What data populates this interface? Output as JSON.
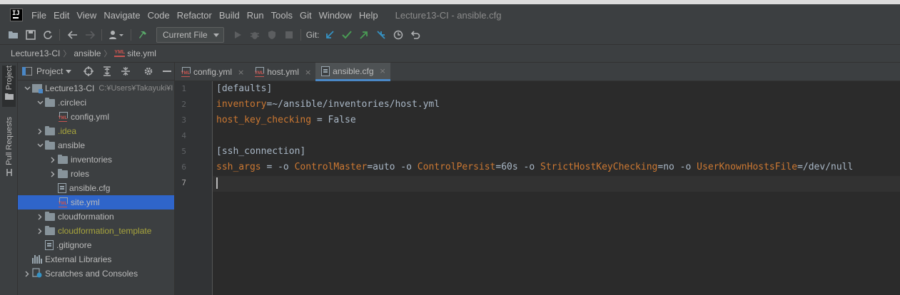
{
  "window": {
    "title": "Lecture13-CI - ansible.cfg",
    "logo_text": "IJ"
  },
  "menu": [
    "File",
    "Edit",
    "View",
    "Navigate",
    "Code",
    "Refactor",
    "Build",
    "Run",
    "Tools",
    "Git",
    "Window",
    "Help"
  ],
  "toolbar": {
    "run_config": "Current File",
    "git_label": "Git:"
  },
  "breadcrumb": {
    "project": "Lecture13-CI",
    "folder": "ansible",
    "file": "site.yml",
    "file_badge": "YML"
  },
  "side_stripe": {
    "project": "Project",
    "pull_requests": "Pull Requests"
  },
  "project_panel": {
    "title": "Project",
    "tree": [
      {
        "label": "Lecture13-CI",
        "hint": "C:¥Users¥Takayuki¥I",
        "icon": "module",
        "arrow": "down",
        "depth": 0
      },
      {
        "label": ".circleci",
        "icon": "folder",
        "arrow": "down",
        "depth": 1
      },
      {
        "label": "config.yml",
        "icon": "yml",
        "arrow": "",
        "depth": 2
      },
      {
        "label": ".idea",
        "icon": "folder",
        "arrow": "right",
        "depth": 1,
        "excluded": true
      },
      {
        "label": "ansible",
        "icon": "folder",
        "arrow": "down",
        "depth": 1
      },
      {
        "label": "inventories",
        "icon": "folder",
        "arrow": "right",
        "depth": 2
      },
      {
        "label": "roles",
        "icon": "folder",
        "arrow": "right",
        "depth": 2
      },
      {
        "label": "ansible.cfg",
        "icon": "cfg",
        "arrow": "",
        "depth": 2
      },
      {
        "label": "site.yml",
        "icon": "yml",
        "arrow": "",
        "depth": 2,
        "selected": true
      },
      {
        "label": "cloudformation",
        "icon": "folder",
        "arrow": "right",
        "depth": 1
      },
      {
        "label": "cloudformation_template",
        "icon": "folder",
        "arrow": "right",
        "depth": 1,
        "excluded": true
      },
      {
        "label": ".gitignore",
        "icon": "cfg",
        "arrow": "",
        "depth": 1
      },
      {
        "label": "External Libraries",
        "icon": "lib",
        "arrow": "",
        "depth": 0
      },
      {
        "label": "Scratches and Consoles",
        "icon": "scratch",
        "arrow": "right",
        "depth": 0
      }
    ]
  },
  "tabs": [
    {
      "label": "config.yml",
      "icon": "yml",
      "active": false
    },
    {
      "label": "host.yml",
      "icon": "yml",
      "active": false
    },
    {
      "label": "ansible.cfg",
      "icon": "cfg",
      "active": true
    }
  ],
  "tab_close": "×",
  "editor": {
    "lines": [
      {
        "num": "1",
        "parts": [
          [
            "p",
            "[defaults]"
          ]
        ]
      },
      {
        "num": "2",
        "parts": [
          [
            "k",
            "inventory"
          ],
          [
            "p",
            "=~/ansible/inventories/host.yml"
          ]
        ]
      },
      {
        "num": "3",
        "parts": [
          [
            "k",
            "host_key_checking"
          ],
          [
            "p",
            " = False"
          ]
        ]
      },
      {
        "num": "4",
        "parts": []
      },
      {
        "num": "5",
        "parts": [
          [
            "p",
            "[ssh_connection]"
          ]
        ]
      },
      {
        "num": "6",
        "parts": [
          [
            "k",
            "ssh_args"
          ],
          [
            "p",
            " = -o "
          ],
          [
            "k",
            "ControlMaster"
          ],
          [
            "p",
            "=auto -o "
          ],
          [
            "k",
            "ControlPersist"
          ],
          [
            "p",
            "=60s -o "
          ],
          [
            "k",
            "StrictHostKeyChecking"
          ],
          [
            "p",
            "=no -o "
          ],
          [
            "k",
            "UserKnownHostsFile"
          ],
          [
            "p",
            "=/dev/null"
          ]
        ]
      },
      {
        "num": "7",
        "parts": [],
        "current": true
      }
    ]
  },
  "colors": {
    "background": "#2b2b2b",
    "keyword": "#cc7832",
    "plain": "#a9b7c6",
    "selection": "#2f65ca",
    "excluded": "#a8a53d"
  }
}
